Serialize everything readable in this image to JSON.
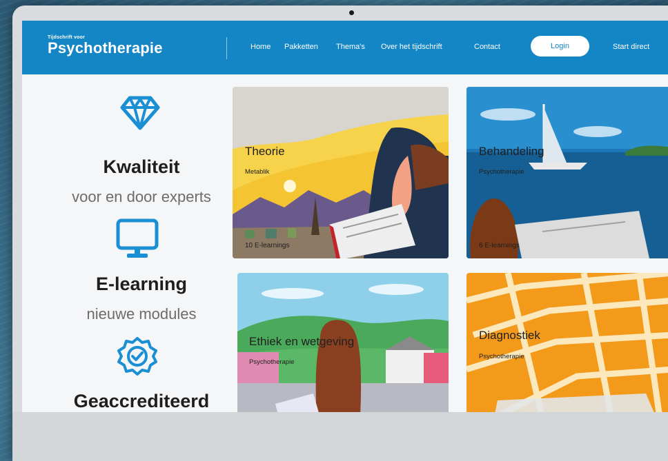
{
  "logo": {
    "small": "Tijdschrift voor",
    "big": "Psychotherapie"
  },
  "nav": {
    "items": [
      "Home",
      "Pakketten",
      "Thema's",
      "Over het tijdschrift",
      "Contact"
    ],
    "login": "Login",
    "start": "Start direct"
  },
  "features": [
    {
      "icon": "diamond-icon",
      "title": "Kwaliteit",
      "subtitle": "voor en door experts"
    },
    {
      "icon": "monitor-icon",
      "title": "E-learning",
      "subtitle": "nieuwe modules"
    },
    {
      "icon": "accredited-badge-icon",
      "title": "Geaccrediteerd",
      "subtitle": ""
    }
  ],
  "cards": [
    {
      "title": "Theorie",
      "subtitle": "Metablik",
      "count": "10 E-learnings"
    },
    {
      "title": "Behandeling",
      "subtitle": "Psychotherapie",
      "count": "6 E-learnings"
    },
    {
      "title": "Ethiek en wetgeving",
      "subtitle": "Psychotherapie",
      "count": ""
    },
    {
      "title": "Diagnostiek",
      "subtitle": "Psychotherapie",
      "count": ""
    }
  ],
  "colors": {
    "brand_blue": "#1486c6",
    "icon_blue": "#1a8fd4",
    "background": "#f5f6f7"
  }
}
